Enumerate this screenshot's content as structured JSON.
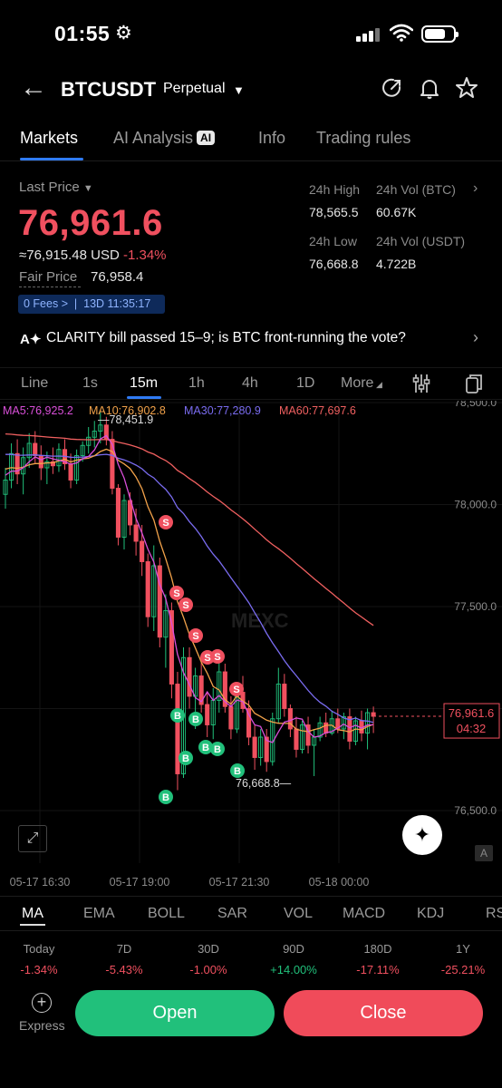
{
  "status_bar": {
    "time": "01:55"
  },
  "header": {
    "pair": "BTCUSDT",
    "contract": "Perpetual"
  },
  "tabs": [
    {
      "label": "Markets"
    },
    {
      "label": "AI Analysis",
      "badge": "AI"
    },
    {
      "label": "Info"
    },
    {
      "label": "Trading rules"
    }
  ],
  "ticker": {
    "last_price_label": "Last Price",
    "last_price": "76,961.6",
    "approx_value": "≈76,915.48",
    "approx_currency": "USD",
    "change_pct": "-1.34%",
    "fair_price_label": "Fair Price",
    "fair_price": "76,958.4",
    "fees_label": "0 Fees",
    "fees_countdown": "13D 11:35:17",
    "stats": {
      "high_label": "24h High",
      "high": "78,565.5",
      "vol_btc_label": "24h Vol (BTC)",
      "vol_btc": "60.67K",
      "low_label": "24h Low",
      "low": "76,668.8",
      "vol_usdt_label": "24h Vol  (USDT)",
      "vol_usdt": "4.722B"
    }
  },
  "news": {
    "text": "CLARITY bill passed 15–9; is BTC front-running the vote?"
  },
  "intervals": [
    "Line",
    "1s",
    "15m",
    "1h",
    "4h",
    "1D",
    "More"
  ],
  "active_interval": "15m",
  "chart_data": {
    "type": "candlestick",
    "ma_legend": [
      {
        "label": "MA5:76,925.2",
        "color": "#d94fd9"
      },
      {
        "label": "MA10:76,902.8",
        "color": "#f2a24a"
      },
      {
        "label": "MA30:77,280.9",
        "color": "#7a6cf0"
      },
      {
        "label": "MA60:77,697.6",
        "color": "#f06060"
      }
    ],
    "y_ticks": [
      "78,500.0",
      "78,000.0",
      "77,500.0",
      "77,000.0",
      "76,500.0"
    ],
    "y_tick_values": [
      78500,
      78000,
      77500,
      77000,
      76500
    ],
    "x_ticks": [
      "05-17 16:30",
      "05-17 19:00",
      "05-17 21:30",
      "05-18 00:00"
    ],
    "high_annotation": "78,451.9",
    "low_annotation": "76,668.8",
    "current_price": "76,961.6",
    "countdown": "04:32",
    "watermark": "MEXC",
    "auto_badge": "A",
    "candles_ohlc": [
      [
        78050,
        78180,
        77980,
        78120
      ],
      [
        78120,
        78300,
        78080,
        78250
      ],
      [
        78250,
        78320,
        78100,
        78150
      ],
      [
        78150,
        78280,
        78050,
        78230
      ],
      [
        78230,
        78350,
        78180,
        78300
      ],
      [
        78300,
        78360,
        78200,
        78240
      ],
      [
        78240,
        78290,
        78120,
        78180
      ],
      [
        78180,
        78260,
        78100,
        78210
      ],
      [
        78210,
        78280,
        78150,
        78190
      ],
      [
        78190,
        78300,
        78160,
        78270
      ],
      [
        78270,
        78320,
        78170,
        78200
      ],
      [
        78200,
        78250,
        78080,
        78120
      ],
      [
        78120,
        78270,
        78100,
        78240
      ],
      [
        78240,
        78310,
        78210,
        78290
      ],
      [
        78290,
        78380,
        78250,
        78330
      ],
      [
        78330,
        78410,
        78280,
        78360
      ],
      [
        78360,
        78452,
        78300,
        78390
      ],
      [
        78390,
        78430,
        78290,
        78320
      ],
      [
        78320,
        78360,
        78050,
        78080
      ],
      [
        78080,
        78100,
        77800,
        77840
      ],
      [
        77840,
        78050,
        77780,
        78020
      ],
      [
        78020,
        78060,
        77850,
        77900
      ],
      [
        77900,
        77980,
        77750,
        77820
      ],
      [
        77820,
        77900,
        77650,
        77720
      ],
      [
        77720,
        77760,
        77400,
        77450
      ],
      [
        77450,
        77800,
        77380,
        77700
      ],
      [
        77700,
        77740,
        77300,
        77350
      ],
      [
        77350,
        77560,
        77200,
        77480
      ],
      [
        77480,
        77520,
        77050,
        77120
      ],
      [
        77120,
        77180,
        76600,
        76680
      ],
      [
        76680,
        77300,
        76660,
        77250
      ],
      [
        77250,
        77300,
        77000,
        77060
      ],
      [
        77060,
        77200,
        76900,
        77160
      ],
      [
        77160,
        77260,
        76980,
        77020
      ],
      [
        77020,
        77080,
        76860,
        76920
      ],
      [
        76920,
        77100,
        76850,
        77040
      ],
      [
        77040,
        77240,
        76980,
        77180
      ],
      [
        77180,
        77220,
        76980,
        77010
      ],
      [
        77010,
        77060,
        76850,
        76900
      ],
      [
        76900,
        77120,
        76880,
        77080
      ],
      [
        77080,
        77160,
        76980,
        77000
      ],
      [
        77000,
        77040,
        76820,
        76860
      ],
      [
        76860,
        76920,
        76700,
        76760
      ],
      [
        76760,
        76900,
        76720,
        76860
      ],
      [
        76860,
        76900,
        76690,
        76740
      ],
      [
        76740,
        76980,
        76720,
        76950
      ],
      [
        76950,
        77200,
        76930,
        77120
      ],
      [
        77120,
        77170,
        76960,
        77000
      ],
      [
        77000,
        77020,
        76860,
        76900
      ],
      [
        76900,
        76960,
        76760,
        76800
      ],
      [
        76800,
        76940,
        76780,
        76920
      ],
      [
        76920,
        76960,
        76780,
        76820
      ],
      [
        76820,
        76900,
        76669,
        76860
      ],
      [
        76860,
        76960,
        76840,
        76930
      ],
      [
        76930,
        76980,
        76860,
        76880
      ],
      [
        76880,
        76990,
        76870,
        76950
      ],
      [
        76950,
        77000,
        76880,
        76900
      ],
      [
        76900,
        76980,
        76850,
        76960
      ],
      [
        76960,
        77000,
        76800,
        76840
      ],
      [
        76840,
        76960,
        76820,
        76940
      ],
      [
        76940,
        76990,
        76840,
        76880
      ],
      [
        76880,
        77000,
        76800,
        76980
      ],
      [
        76980,
        77010,
        76880,
        76962
      ]
    ]
  },
  "indicators": [
    "MA",
    "EMA",
    "BOLL",
    "SAR",
    "VOL",
    "MACD",
    "KDJ",
    "RSI"
  ],
  "active_indicator": "MA",
  "performance": [
    {
      "label": "Today",
      "value": "-1.34%",
      "sign": "neg"
    },
    {
      "label": "7D",
      "value": "-5.43%",
      "sign": "neg"
    },
    {
      "label": "30D",
      "value": "-1.00%",
      "sign": "neg"
    },
    {
      "label": "90D",
      "value": "+14.00%",
      "sign": "pos"
    },
    {
      "label": "180D",
      "value": "-17.11%",
      "sign": "neg"
    },
    {
      "label": "1Y",
      "value": "-25.21%",
      "sign": "neg"
    }
  ],
  "footer": {
    "express_label": "Express",
    "open_label": "Open",
    "close_label": "Close"
  },
  "colors": {
    "up": "#21c07b",
    "down": "#f0505f",
    "accent": "#2f7bf5"
  }
}
